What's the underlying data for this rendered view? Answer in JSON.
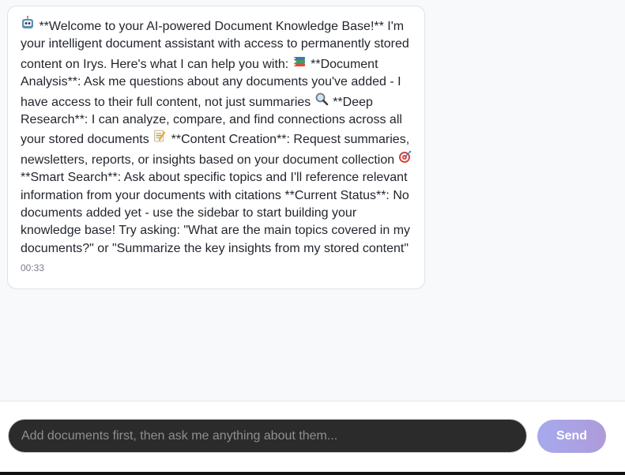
{
  "chat": {
    "message": {
      "seg1": "**Welcome to your AI-powered Document Knowledge Base!** I'm your intelligent document assistant with access to permanently stored content on Irys. Here's what I can help you with:",
      "seg2": "**Document Analysis**: Ask me questions about any documents you've added - I have access to their full content, not just summaries",
      "seg3": "**Deep Research**: I can analyze, compare, and find connections across all your stored documents",
      "seg4": "**Content Creation**: Request summaries, newsletters, reports, or insights based on your document collection",
      "seg5": "**Smart Search**: Ask about specific topics and I'll reference relevant information from your documents with citations **Current Status**: No documents added yet - use the sidebar to start building your knowledge base! Try asking: \"What are the main topics covered in my documents?\" or \"Summarize the key insights from my stored content\"",
      "timestamp": "00:33",
      "icons": [
        "robot-icon",
        "books-icon",
        "magnifier-icon",
        "memo-icon",
        "target-icon"
      ]
    }
  },
  "composer": {
    "placeholder": "Add documents first, then ask me anything about them...",
    "value": "",
    "send_label": "Send"
  },
  "colors": {
    "background": "#f8f9fb",
    "bubble": "#ffffff",
    "input_bg": "#2b2b2b",
    "send_gradient_start": "#a6a9ee",
    "send_gradient_end": "#ae9bd9"
  }
}
